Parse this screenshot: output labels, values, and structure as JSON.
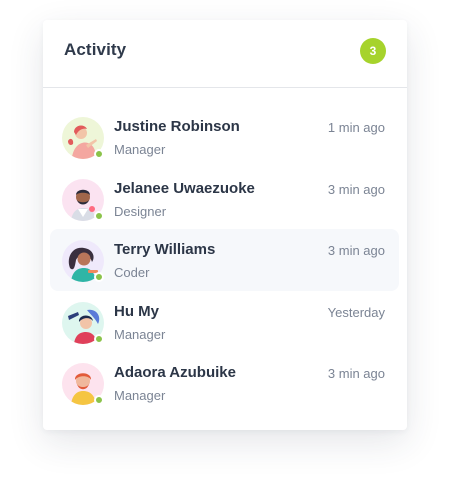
{
  "header": {
    "title": "Activity",
    "badge_count": "3",
    "badge_color": "#a6d32c"
  },
  "colors": {
    "online": "#8bc34a",
    "active_row": "#f6f8fb"
  },
  "activity": [
    {
      "name": "Justine Robinson",
      "role": "Manager",
      "time": "1 min ago",
      "avatar_bg": "#eef6d8",
      "online": true,
      "active": false,
      "icon": "avatar-justine"
    },
    {
      "name": "Jelanee Uwaezuoke",
      "role": "Designer",
      "time": "3 min ago",
      "avatar_bg": "#fbe3f1",
      "online": true,
      "active": false,
      "icon": "avatar-jelanee"
    },
    {
      "name": "Terry Williams",
      "role": "Coder",
      "time": "3 min ago",
      "avatar_bg": "#efe9fb",
      "online": true,
      "active": true,
      "icon": "avatar-terry"
    },
    {
      "name": "Hu My",
      "role": "Manager",
      "time": "Yesterday",
      "avatar_bg": "#def6ef",
      "online": true,
      "active": false,
      "icon": "avatar-hu"
    },
    {
      "name": "Adaora Azubuike",
      "role": "Manager",
      "time": "3 min ago",
      "avatar_bg": "#fde3ee",
      "online": true,
      "active": false,
      "icon": "avatar-adaora"
    }
  ]
}
